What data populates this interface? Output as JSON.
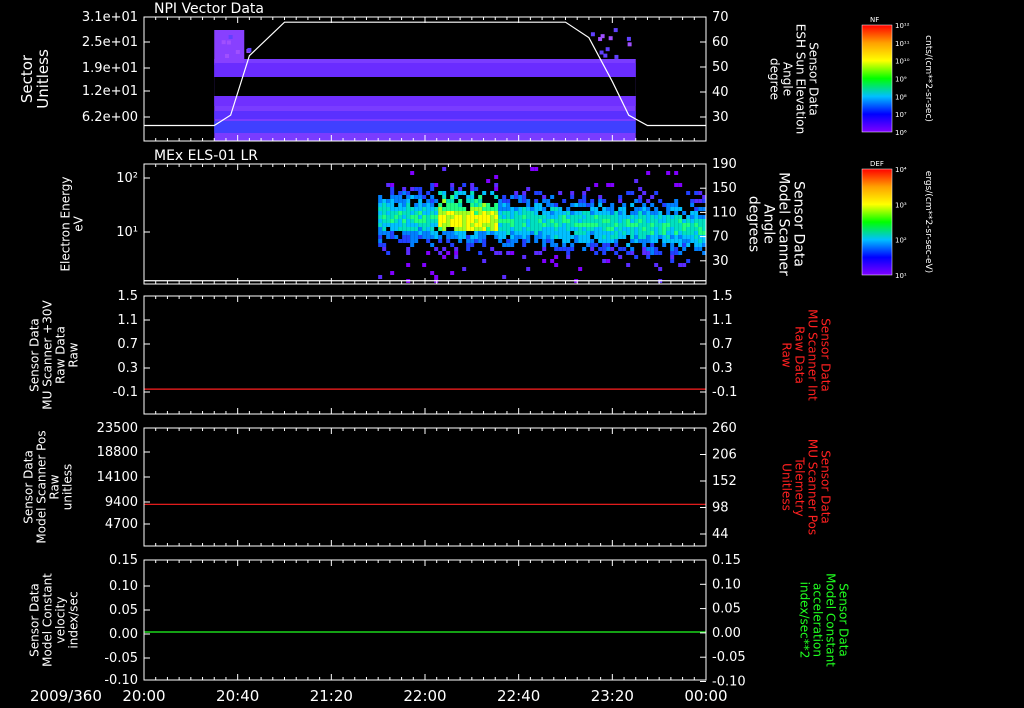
{
  "chart_data": [
    {
      "type": "heatmap",
      "title": "NPI Vector Data",
      "ylabel_left": [
        "Sector",
        "Unitless"
      ],
      "yticks_left": [
        "3.1e+01",
        "2.5e+01",
        "1.9e+01",
        "1.2e+01",
        "6.2e+00"
      ],
      "ylabel_right": [
        "Sensor Data",
        "ESH Sun Elevation",
        "Angle",
        "degree"
      ],
      "yticks_right": [
        "70",
        "60",
        "50",
        "40",
        "30"
      ],
      "ylim_right": [
        22,
        70
      ],
      "line_series": {
        "x": [
          "20:00",
          "20:30",
          "20:37",
          "20:45",
          "21:00",
          "21:30",
          "22:00",
          "22:30",
          "23:00",
          "23:10",
          "23:20",
          "23:27",
          "23:35",
          "00:00"
        ],
        "y": [
          28,
          28,
          32,
          55,
          68,
          68,
          68,
          68,
          68,
          62,
          45,
          32,
          28,
          28
        ]
      },
      "data_start": "20:30",
      "data_end": "23:30",
      "colorbar": {
        "label": "NF",
        "units": "cnts/(cm**2-sr-sec)",
        "ticks": [
          "10¹²",
          "10¹¹",
          "10¹⁰",
          "10⁹",
          "10⁸",
          "10⁷",
          "10⁶"
        ],
        "colors": [
          "#ff0000",
          "#ffa000",
          "#ffff00",
          "#00ff00",
          "#00c0ff",
          "#0000ff",
          "#8000ff"
        ]
      }
    },
    {
      "type": "heatmap",
      "title": "MEx ELS-01 LR",
      "ylabel_left": [
        "Electron Energy",
        "eV"
      ],
      "yticks_left": [
        "10²",
        "10¹"
      ],
      "ylabel_right": [
        "Sensor Data",
        "Model Scanner",
        "Angle",
        "degrees"
      ],
      "yticks_right": [
        "190",
        "150",
        "110",
        "70",
        "30"
      ],
      "ylim_right": [
        5,
        190
      ],
      "line_series": {
        "x": [
          "20:00",
          "00:00"
        ],
        "y": [
          10,
          10
        ]
      },
      "data_start": "21:40",
      "burst_start": "22:05",
      "colorbar": {
        "label": "DEF",
        "units": "ergs/(cm**2-sr-sec-eV)",
        "ticks": [
          "10⁴",
          "10³",
          "10²",
          "10¹"
        ],
        "colors": [
          "#ff0000",
          "#ffa000",
          "#ffff00",
          "#00ff00",
          "#00c0ff",
          "#0000ff",
          "#8000ff"
        ]
      }
    },
    {
      "type": "line",
      "ylabel_left": [
        "Sensor Data",
        "MU Scanner +30V",
        "Raw Data",
        "Raw"
      ],
      "yticks_left": [
        "1.5",
        "1.1",
        "0.7",
        "0.3",
        "-0.1"
      ],
      "ylim_left": [
        -0.4,
        1.5
      ],
      "ylabel_right": [
        "Sensor Data",
        "MU Scanner Int",
        "Raw Data",
        "Raw"
      ],
      "yticks_right": [
        "1.5",
        "1.1",
        "0.7",
        "0.3",
        "-0.1"
      ],
      "series": [
        {
          "x": [
            "20:00",
            "00:00"
          ],
          "y": [
            0.0,
            0.0
          ],
          "color": "#ff2020"
        }
      ]
    },
    {
      "type": "line",
      "ylabel_left": [
        "Sensor Data",
        "Model Scanner Pos",
        "Raw",
        "unitless"
      ],
      "yticks_left": [
        "23500",
        "18800",
        "14100",
        "9400",
        "4700"
      ],
      "ylim_left": [
        0,
        23500
      ],
      "ylabel_right": [
        "Sensor Data",
        "MU Scanner Pos",
        "Telemetry",
        "Unitless"
      ],
      "yticks_right": [
        "260",
        "206",
        "152",
        "98",
        "44"
      ],
      "series": [
        {
          "x": [
            "20:00",
            "00:00"
          ],
          "y": [
            8300,
            8300
          ],
          "color": "#ff2020"
        }
      ]
    },
    {
      "type": "line",
      "ylabel_left": [
        "Sensor Data",
        "Model Constant",
        "velocity",
        "index/sec"
      ],
      "yticks_left": [
        "0.15",
        "0.10",
        "0.05",
        "0.00",
        "-0.05",
        "-0.10"
      ],
      "ylim_left": [
        -0.1,
        0.15
      ],
      "ylabel_right": [
        "Sensor Data",
        "Model Constant",
        "acceleration",
        "index/sec**2"
      ],
      "yticks_right": [
        "0.15",
        "0.10",
        "0.05",
        "0.00",
        "-0.05",
        "-0.10"
      ],
      "series": [
        {
          "x": [
            "20:00",
            "00:00"
          ],
          "y": [
            0.0,
            0.0
          ],
          "color": "#20ff20"
        }
      ]
    }
  ],
  "xaxis": {
    "date_label": "2009/360",
    "ticks": [
      "20:00",
      "20:40",
      "21:20",
      "22:00",
      "22:40",
      "23:20",
      "00:00"
    ]
  },
  "colors": {
    "axis": "#ffffff",
    "red_label": "#ff2020",
    "green_label": "#20ff20"
  }
}
